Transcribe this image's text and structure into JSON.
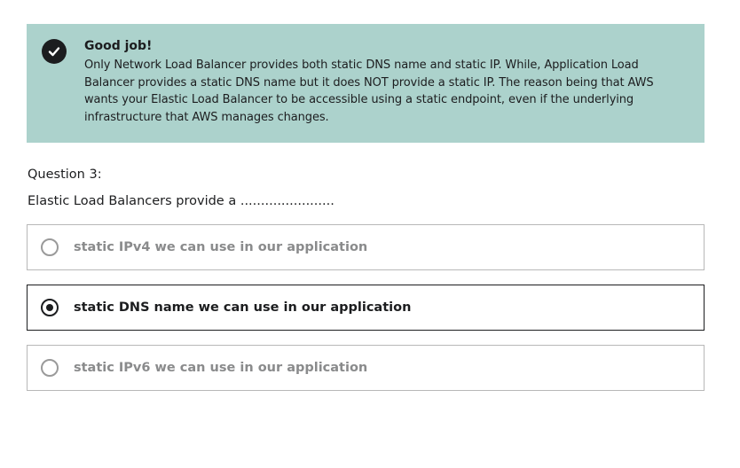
{
  "feedback": {
    "title": "Good job!",
    "body": "Only Network Load Balancer provides both static DNS name and static IP. While, Application Load Balancer provides a static DNS name but it does NOT provide a static IP. The reason being that AWS wants your Elastic Load Balancer to be accessible using a static endpoint, even if the underlying infrastructure that AWS manages changes.",
    "icon": "check-circle-icon",
    "background_color": "#acd2cc"
  },
  "question": {
    "label": "Question 3:",
    "text": "Elastic Load Balancers provide a ......................."
  },
  "options": [
    {
      "label": "static IPv4 we can use in our application",
      "selected": false
    },
    {
      "label": "static DNS name we can use in our application",
      "selected": true
    },
    {
      "label": "static IPv6 we can use in our application",
      "selected": false
    }
  ]
}
